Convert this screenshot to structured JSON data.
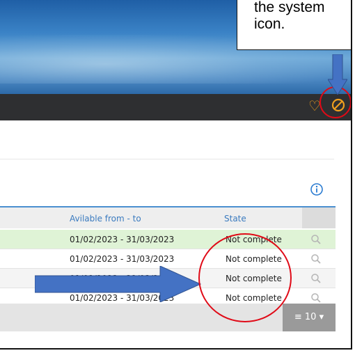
{
  "callout": {
    "lines": [
      "the system",
      "icon."
    ]
  },
  "topbar": {
    "user_icon": "user-icon",
    "system_icon": "block-icon"
  },
  "info_icon": "info-icon",
  "table": {
    "headers": [
      "Avilable from - to",
      "State"
    ],
    "rows": [
      {
        "range": "01/02/2023 - 31/03/2023",
        "state": "Not complete",
        "highlighted": true
      },
      {
        "range": "01/02/2023 - 31/03/2023",
        "state": "Not complete",
        "highlighted": false
      },
      {
        "range": "01/02/2023 - 31/03/2023",
        "state": "Not complete",
        "highlighted": false
      },
      {
        "range": "01/02/2023 - 31/03/2023",
        "state": "Not complete",
        "highlighted": false
      }
    ]
  },
  "pager": {
    "page_size": "10"
  },
  "colors": {
    "accent": "#4b8fd0",
    "icon_orange": "#ef9f1e",
    "highlight_red": "#e00a17",
    "row_highlight": "#dff3d6",
    "arrow_blue": "#4472c4"
  }
}
